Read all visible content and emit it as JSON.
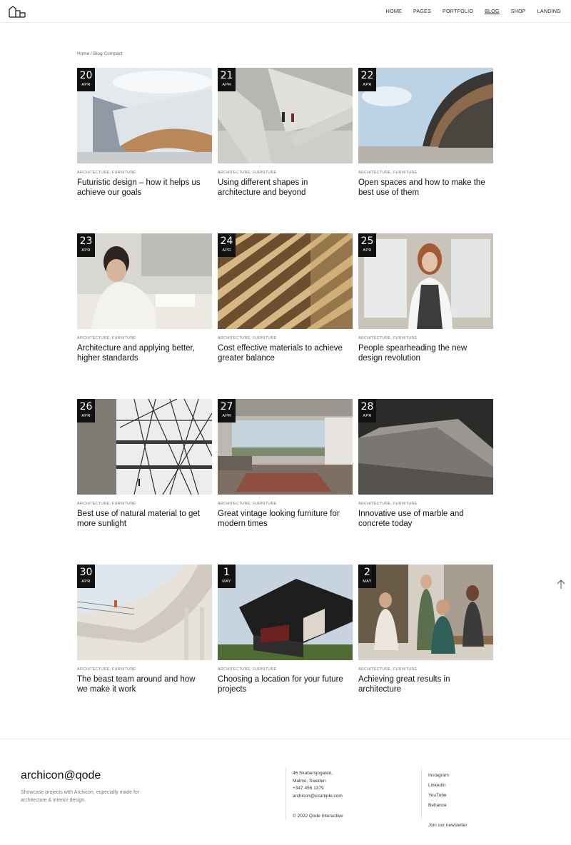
{
  "nav": {
    "items": [
      "HOME",
      "PAGES",
      "PORTFOLIO",
      "BLOG",
      "SHOP",
      "LANDING"
    ],
    "active": "BLOG"
  },
  "breadcrumb": "Home / Blog Compact",
  "posts": [
    {
      "day": "20",
      "month": "APR",
      "cats": "ARCHITECTURE, FURNITURE",
      "title": "Futuristic design – how it helps us achieve our goals"
    },
    {
      "day": "21",
      "month": "APR",
      "cats": "ARCHITECTURE, FURNITURE",
      "title": "Using different shapes in architecture and beyond"
    },
    {
      "day": "22",
      "month": "APR",
      "cats": "ARCHITECTURE, FURNITURE",
      "title": "Open spaces and how to make the best use of them"
    },
    {
      "day": "23",
      "month": "APR",
      "cats": "ARCHITECTURE, FURNITURE",
      "title": "Architecture and applying better, higher standards"
    },
    {
      "day": "24",
      "month": "APR",
      "cats": "ARCHITECTURE, FURNITURE",
      "title": "Cost effective materials to achieve greater balance"
    },
    {
      "day": "25",
      "month": "APR",
      "cats": "ARCHITECTURE, FURNITURE",
      "title": "People spearheading the new design revolution"
    },
    {
      "day": "26",
      "month": "APR",
      "cats": "ARCHITECTURE, FURNITURE",
      "title": "Best use of natural material to get more sunlight"
    },
    {
      "day": "27",
      "month": "APR",
      "cats": "ARCHITECTURE, FURNITURE",
      "title": "Great vintage looking furniture for modern times"
    },
    {
      "day": "28",
      "month": "APR",
      "cats": "ARCHITECTURE, FURNITURE",
      "title": "Innovative use of marble and concrete today"
    },
    {
      "day": "30",
      "month": "APR",
      "cats": "ARCHITECTURE, FURNITURE",
      "title": "The beast team around and how we make it work"
    },
    {
      "day": "1",
      "month": "MAY",
      "cats": "ARCHITECTURE, FURNITURE",
      "title": "Choosing a location for your future projects"
    },
    {
      "day": "2",
      "month": "MAY",
      "cats": "ARCHITECTURE, FURNITURE",
      "title": "Achieving great results in architecture"
    }
  ],
  "scroll_top_icon": "arrow-up-icon",
  "footer": {
    "brand": "archicon@qode",
    "tagline": "Showcase projects with Archicon, especially made for architecture & interior design.",
    "address_line1": "46 Skabersjogatan,",
    "address_line2": "Malmo, Sweden",
    "phone": "+347 456 1379",
    "email": "archicon@example.com",
    "copyright": "© 2022 Qode Interactive",
    "social": [
      "Instagram",
      "LinkedIn",
      "YouTube",
      "Behance"
    ],
    "newsletter": "Join our newsletter"
  }
}
